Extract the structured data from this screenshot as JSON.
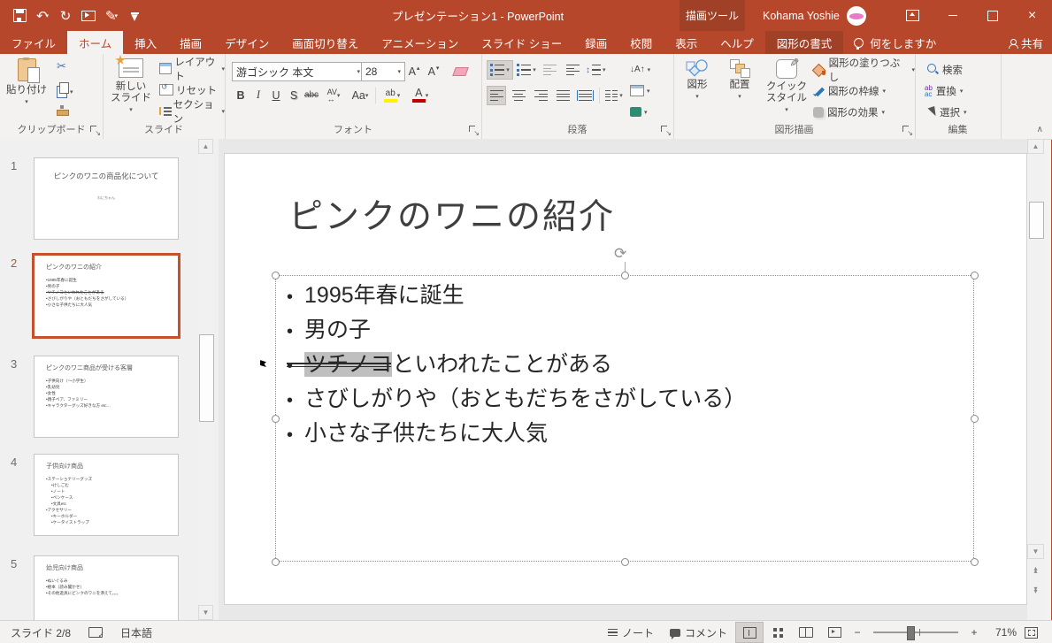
{
  "titlebar": {
    "title": "プレゼンテーション1 - PowerPoint",
    "contextual_tool": "描画ツール",
    "user_name": "Kohama Yoshie"
  },
  "tabs": {
    "file": "ファイル",
    "home": "ホーム",
    "insert": "挿入",
    "draw": "描画",
    "design": "デザイン",
    "transitions": "画面切り替え",
    "animations": "アニメーション",
    "slideshow": "スライド ショー",
    "record": "録画",
    "review": "校閲",
    "view": "表示",
    "help": "ヘルプ",
    "shape_format": "図形の書式",
    "tell_me": "何をしますか",
    "share": "共有"
  },
  "ribbon": {
    "clipboard": {
      "group_label": "クリップボード",
      "paste": "貼り付け"
    },
    "slides": {
      "group_label": "スライド",
      "new_slide": "新しい スライド",
      "layout": "レイアウト",
      "reset": "リセット",
      "section": "セクション"
    },
    "font": {
      "group_label": "フォント",
      "font_name": "游ゴシック 本文",
      "font_size": "28"
    },
    "paragraph": {
      "group_label": "段落"
    },
    "drawing": {
      "group_label": "図形描画",
      "shapes": "図形",
      "arrange": "配置",
      "quick_styles": "クイック スタイル",
      "shape_fill": "図形の塗りつぶし",
      "shape_outline": "図形の枠線",
      "shape_effects": "図形の効果"
    },
    "editing": {
      "group_label": "編集",
      "find": "検索",
      "replace": "置換",
      "select": "選択"
    }
  },
  "thumbnails": [
    {
      "number": "1",
      "title": "ピンクのワニの商品化について",
      "subtitle": "わにちゃん"
    },
    {
      "number": "2",
      "title": "ピンクのワニの紹介",
      "bullets": [
        "1995年春に誕生",
        "男の子",
        "ツチノコといわれたことがある",
        "さびしがりや（おともだちをさがしている）",
        "小さな子供たちに大人気"
      ]
    },
    {
      "number": "3",
      "title": "ピンクのワニ商品が受ける客層",
      "bullets": [
        "子供向け（〜小学生）",
        "乳幼児",
        "女性",
        "親子ペア、ファミリー",
        "キャラクターグッズ好きな方 etc…"
      ]
    },
    {
      "number": "4",
      "title": "子供向け商品",
      "bullets": [
        "ステーショナリーグッズ",
        "けしごむ",
        "ノート",
        "ペンケース",
        "文具etc",
        "アクセサリー",
        "キーホルダー",
        "ケータイストラップ"
      ]
    },
    {
      "number": "5",
      "title": "幼児向け商品",
      "bullets": [
        "ぬいぐるみ",
        "絵本（読み聞かせ）",
        "その他遊具にピンクのワニを添えて。。。"
      ]
    }
  ],
  "slide": {
    "title": "ピンクのワニの紹介",
    "bullets": [
      {
        "text": "1995年春に誕生"
      },
      {
        "text": "男の子"
      },
      {
        "struck": "ツチノコ",
        "text": "といわれたことがある"
      },
      {
        "text": "さびしがりや（おともだちをさがしている）"
      },
      {
        "text": "小さな子供たちに大人気"
      }
    ]
  },
  "statusbar": {
    "slide_indicator": "スライド 2/8",
    "language": "日本語",
    "notes": "ノート",
    "comments": "コメント",
    "zoom_level": "71%"
  },
  "colors": {
    "accent": "#B7472A",
    "contextual_tab": "#A04027",
    "selection_highlight": "#BFBFBF",
    "thumb_selected_border": "#C4502E",
    "highlight_yellow": "#FFF200",
    "font_color_red": "#C00000"
  }
}
